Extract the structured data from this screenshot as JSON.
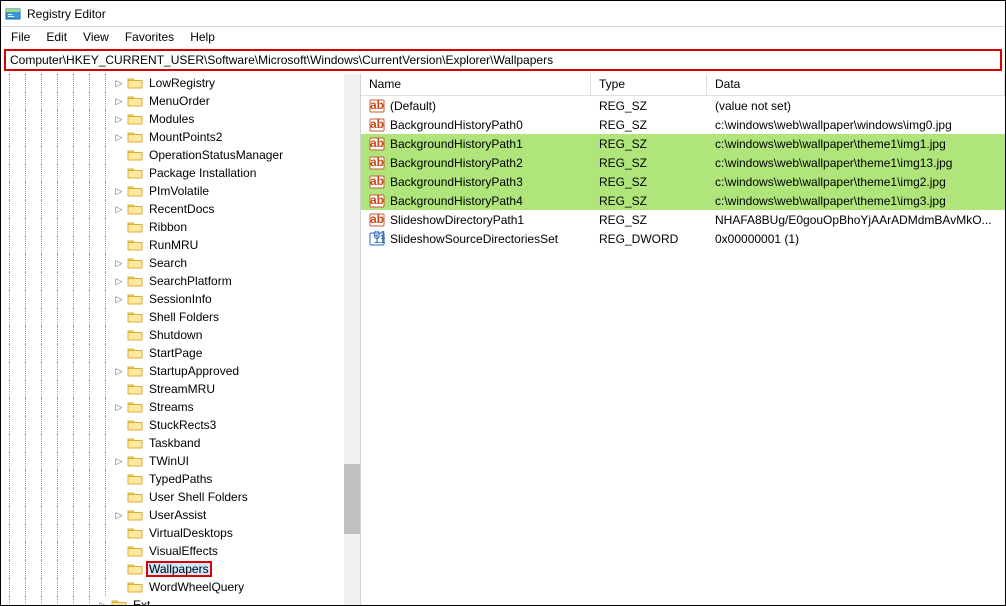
{
  "window": {
    "title": "Registry Editor"
  },
  "menu": {
    "file": "File",
    "edit": "Edit",
    "view": "View",
    "favorites": "Favorites",
    "help": "Help"
  },
  "address": {
    "path": "Computer\\HKEY_CURRENT_USER\\Software\\Microsoft\\Windows\\CurrentVersion\\Explorer\\Wallpapers"
  },
  "tree": {
    "items": [
      {
        "label": "LowRegistry",
        "expandable": true
      },
      {
        "label": "MenuOrder",
        "expandable": true
      },
      {
        "label": "Modules",
        "expandable": true
      },
      {
        "label": "MountPoints2",
        "expandable": true
      },
      {
        "label": "OperationStatusManager",
        "expandable": false
      },
      {
        "label": "Package Installation",
        "expandable": false
      },
      {
        "label": "PImVolatile",
        "expandable": true
      },
      {
        "label": "RecentDocs",
        "expandable": true
      },
      {
        "label": "Ribbon",
        "expandable": false
      },
      {
        "label": "RunMRU",
        "expandable": false
      },
      {
        "label": "Search",
        "expandable": true
      },
      {
        "label": "SearchPlatform",
        "expandable": true
      },
      {
        "label": "SessionInfo",
        "expandable": true
      },
      {
        "label": "Shell Folders",
        "expandable": false
      },
      {
        "label": "Shutdown",
        "expandable": false
      },
      {
        "label": "StartPage",
        "expandable": false
      },
      {
        "label": "StartupApproved",
        "expandable": true
      },
      {
        "label": "StreamMRU",
        "expandable": false
      },
      {
        "label": "Streams",
        "expandable": true
      },
      {
        "label": "StuckRects3",
        "expandable": false
      },
      {
        "label": "Taskband",
        "expandable": false
      },
      {
        "label": "TWinUI",
        "expandable": true
      },
      {
        "label": "TypedPaths",
        "expandable": false
      },
      {
        "label": "User Shell Folders",
        "expandable": false
      },
      {
        "label": "UserAssist",
        "expandable": true
      },
      {
        "label": "VirtualDesktops",
        "expandable": false
      },
      {
        "label": "VisualEffects",
        "expandable": false
      },
      {
        "label": "Wallpapers",
        "expandable": false,
        "selected": true
      },
      {
        "label": "WordWheelQuery",
        "expandable": false
      }
    ],
    "ext_label": "Ext"
  },
  "list": {
    "columns": {
      "name": "Name",
      "type": "Type",
      "data": "Data"
    },
    "rows": [
      {
        "name": "(Default)",
        "type": "REG_SZ",
        "data": "(value not set)",
        "icon": "sz",
        "hl": false
      },
      {
        "name": "BackgroundHistoryPath0",
        "type": "REG_SZ",
        "data": "c:\\windows\\web\\wallpaper\\windows\\img0.jpg",
        "icon": "sz",
        "hl": false
      },
      {
        "name": "BackgroundHistoryPath1",
        "type": "REG_SZ",
        "data": "c:\\windows\\web\\wallpaper\\theme1\\img1.jpg",
        "icon": "sz",
        "hl": true
      },
      {
        "name": "BackgroundHistoryPath2",
        "type": "REG_SZ",
        "data": "c:\\windows\\web\\wallpaper\\theme1\\img13.jpg",
        "icon": "sz",
        "hl": true
      },
      {
        "name": "BackgroundHistoryPath3",
        "type": "REG_SZ",
        "data": "c:\\windows\\web\\wallpaper\\theme1\\img2.jpg",
        "icon": "sz",
        "hl": true
      },
      {
        "name": "BackgroundHistoryPath4",
        "type": "REG_SZ",
        "data": "c:\\windows\\web\\wallpaper\\theme1\\img3.jpg",
        "icon": "sz",
        "hl": true
      },
      {
        "name": "SlideshowDirectoryPath1",
        "type": "REG_SZ",
        "data": "NHAFA8BUg/E0gouOpBhoYjAArADMdmBAvMkO...",
        "icon": "sz",
        "hl": false
      },
      {
        "name": "SlideshowSourceDirectoriesSet",
        "type": "REG_DWORD",
        "data": "0x00000001 (1)",
        "icon": "dw",
        "hl": false
      }
    ]
  }
}
